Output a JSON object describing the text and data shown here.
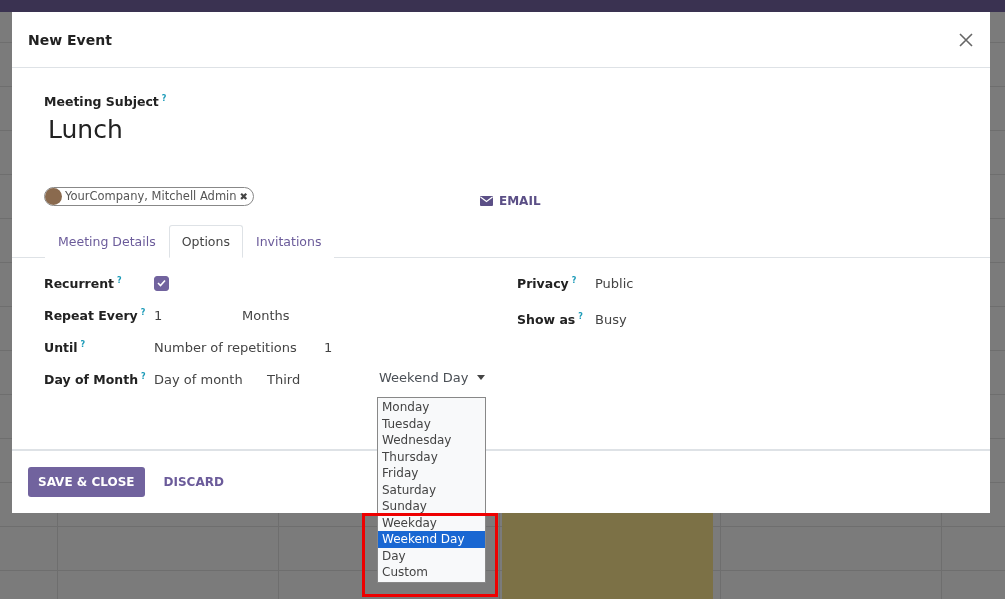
{
  "dialog": {
    "title": "New Event"
  },
  "subject": {
    "label": "Meeting Subject",
    "help": "?",
    "value": "Lunch"
  },
  "attendees": [
    {
      "name": "YourCompany, Mitchell Admin",
      "remove": "✖"
    }
  ],
  "email_button": "EMAIL",
  "tabs": [
    {
      "label": "Meeting Details",
      "selected": false
    },
    {
      "label": "Options",
      "selected": true
    },
    {
      "label": "Invitations",
      "selected": false
    }
  ],
  "options": {
    "recurrent": {
      "label": "Recurrent",
      "help": "?",
      "checked": true
    },
    "repeat_every": {
      "label": "Repeat Every",
      "help": "?",
      "interval": "1",
      "unit": "Months"
    },
    "until": {
      "label": "Until",
      "help": "?",
      "type": "Number of repetitions",
      "count": "1"
    },
    "day_of_month": {
      "label": "Day of Month",
      "help": "?",
      "mode": "Day of month",
      "position": "Third",
      "weekday": "Weekend Day"
    },
    "privacy": {
      "label": "Privacy",
      "help": "?",
      "value": "Public"
    },
    "show_as": {
      "label": "Show as",
      "help": "?",
      "value": "Busy"
    }
  },
  "weekday_dropdown": [
    {
      "label": "Monday",
      "selected": false
    },
    {
      "label": "Tuesday",
      "selected": false
    },
    {
      "label": "Wednesday",
      "selected": false
    },
    {
      "label": "Thursday",
      "selected": false
    },
    {
      "label": "Friday",
      "selected": false
    },
    {
      "label": "Saturday",
      "selected": false
    },
    {
      "label": "Sunday",
      "selected": false
    },
    {
      "label": "Weekday",
      "selected": false
    },
    {
      "label": "Weekend Day",
      "selected": true
    },
    {
      "label": "Day",
      "selected": false
    },
    {
      "label": "Custom",
      "selected": false
    }
  ],
  "footer": {
    "save": "SAVE & CLOSE",
    "discard": "DISCARD"
  }
}
